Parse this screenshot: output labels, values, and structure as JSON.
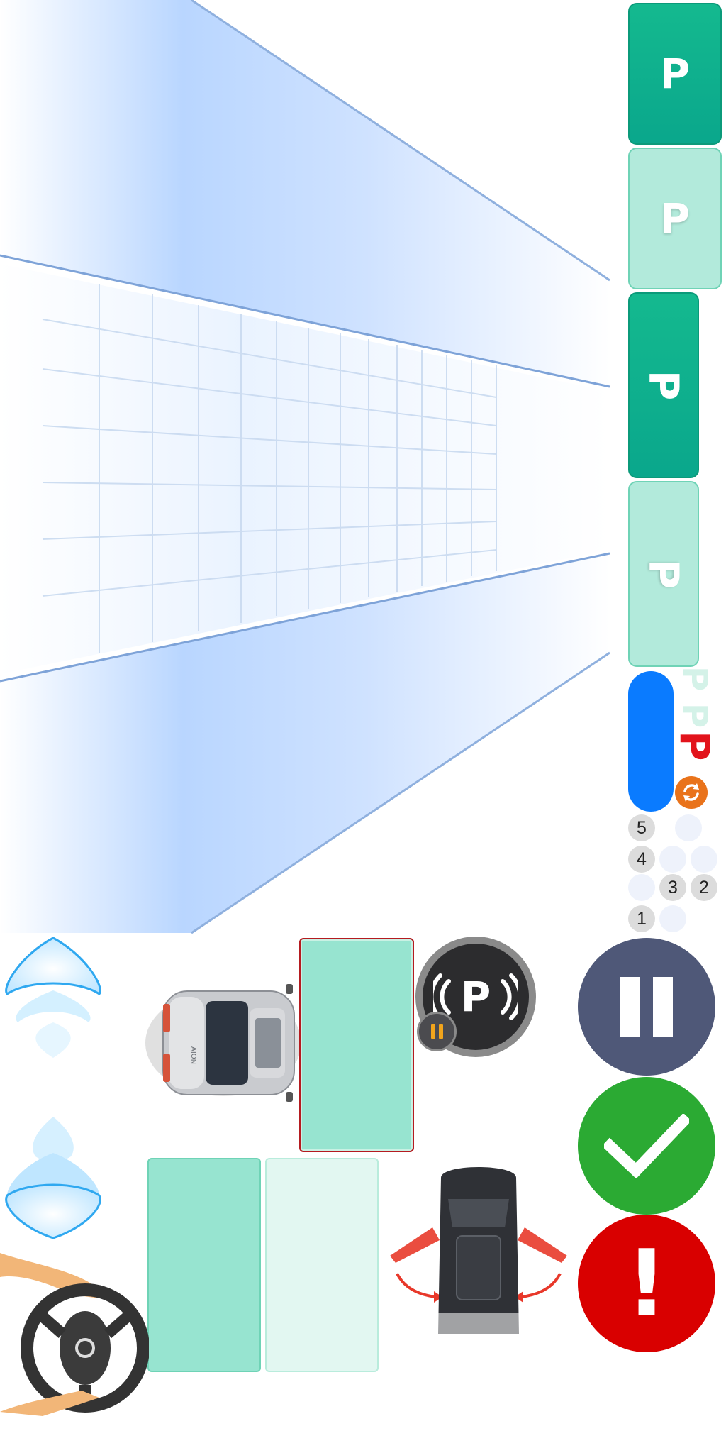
{
  "colors": {
    "slot_dark": "#0aa78c",
    "slot_light": "#b2eadb",
    "parking_space": "#97e4d0",
    "parking_space_light": "#e2f7f1",
    "selected_border": "#b51b20",
    "indicator_blue": "#0a7bff",
    "brand_red": "#e2131b",
    "pause_button": "#4f5878",
    "confirm_button": "#2baa33",
    "alert_button": "#d90000",
    "badge_orange": "#e9731b"
  },
  "parking_slots": [
    {
      "label": "P",
      "style": "dark",
      "orientation": "upright"
    },
    {
      "label": "P",
      "style": "light",
      "orientation": "upright"
    },
    {
      "label": "P",
      "style": "dark",
      "orientation": "rotated"
    },
    {
      "label": "P",
      "style": "light",
      "orientation": "rotated"
    }
  ],
  "status": {
    "brand_mark": "P",
    "refresh_icon": "refresh-icon"
  },
  "step_counter": {
    "numbers": [
      "5",
      "4",
      "3",
      "2",
      "1"
    ]
  },
  "car_view": {
    "car_badge": "AION",
    "park_assist_label": "P",
    "park_assist_icon": "parking-sensor-icon"
  },
  "actions": {
    "pause": "pause-icon",
    "confirm": "checkmark-icon",
    "alert_label": "!"
  }
}
